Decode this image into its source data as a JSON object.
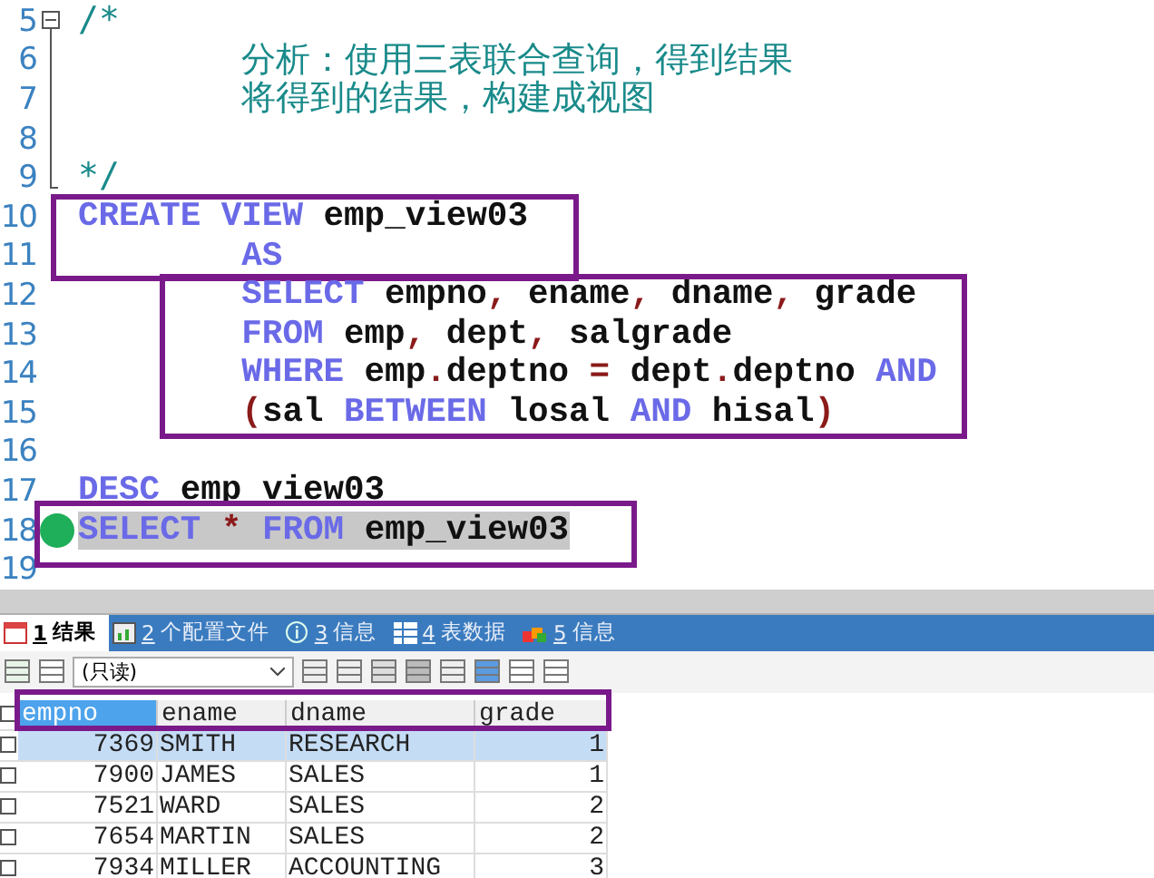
{
  "editor": {
    "blocks": [
      {
        "boxed": false,
        "foldable": true,
        "lines": [
          {
            "number": "5",
            "tokens": [
              {
                "kind": "comment",
                "text": "/*"
              }
            ]
          },
          {
            "number": "6",
            "indent": true,
            "tokens": [
              {
                "kind": "comment",
                "text": "分析：使用三表联合查询，得到结果"
              }
            ]
          },
          {
            "number": "7",
            "indent": true,
            "tokens": [
              {
                "kind": "comment",
                "text": "将得到的结果，构建成视图"
              }
            ]
          },
          {
            "number": "8"
          },
          {
            "number": "9",
            "tokens": [
              {
                "kind": "comment",
                "text": "*/"
              }
            ]
          }
        ]
      },
      {
        "boxed": true,
        "lines": [
          {
            "number": "10",
            "tokens": [
              {
                "kind": "keyword",
                "text": "CREATE VIEW"
              },
              {
                "kind": "ident",
                "text": " emp_view03"
              }
            ]
          },
          {
            "number": "11",
            "indent": true,
            "tokens": [
              {
                "kind": "keyword",
                "text": "AS"
              }
            ]
          }
        ]
      },
      {
        "boxed": true,
        "lines": [
          {
            "number": "12",
            "indent": true,
            "tokens": [
              {
                "kind": "keyword",
                "text": "SELECT"
              },
              {
                "kind": "ident",
                "text": " empno"
              },
              {
                "kind": "punct",
                "text": ","
              },
              {
                "kind": "ident",
                "text": " ename"
              },
              {
                "kind": "punct",
                "text": ","
              },
              {
                "kind": "ident",
                "text": " dname"
              },
              {
                "kind": "punct",
                "text": ","
              },
              {
                "kind": "ident",
                "text": " grade"
              }
            ]
          },
          {
            "number": "13",
            "indent": true,
            "tokens": [
              {
                "kind": "keyword",
                "text": "FROM"
              },
              {
                "kind": "ident",
                "text": " emp"
              },
              {
                "kind": "punct",
                "text": ","
              },
              {
                "kind": "ident",
                "text": " dept"
              },
              {
                "kind": "punct",
                "text": ","
              },
              {
                "kind": "ident",
                "text": " salgrade"
              }
            ]
          },
          {
            "number": "14",
            "indent": true,
            "tokens": [
              {
                "kind": "keyword",
                "text": "WHERE"
              },
              {
                "kind": "ident",
                "text": " emp"
              },
              {
                "kind": "punct",
                "text": "."
              },
              {
                "kind": "ident",
                "text": "deptno "
              },
              {
                "kind": "punct",
                "text": "="
              },
              {
                "kind": "ident",
                "text": " dept"
              },
              {
                "kind": "punct",
                "text": "."
              },
              {
                "kind": "ident",
                "text": "deptno "
              },
              {
                "kind": "keyword",
                "text": "AND"
              }
            ]
          },
          {
            "number": "15",
            "indent": true,
            "tokens": [
              {
                "kind": "punct",
                "text": "("
              },
              {
                "kind": "ident",
                "text": "sal "
              },
              {
                "kind": "keyword",
                "text": "BETWEEN"
              },
              {
                "kind": "ident",
                "text": " losal "
              },
              {
                "kind": "keyword",
                "text": "AND"
              },
              {
                "kind": "ident",
                "text": " hisal"
              },
              {
                "kind": "punct",
                "text": ")"
              }
            ]
          }
        ]
      },
      {
        "boxed": false,
        "lines": [
          {
            "number": "16"
          },
          {
            "number": "17",
            "tokens": [
              {
                "kind": "keyword",
                "text": "DESC"
              },
              {
                "kind": "ident",
                "text": " emp_view03"
              }
            ]
          }
        ]
      },
      {
        "boxed": true,
        "lines": [
          {
            "number": "18",
            "selected": true,
            "cursor": true,
            "tokens": [
              {
                "kind": "keyword",
                "text": "SELECT "
              },
              {
                "kind": "punct",
                "text": "*"
              },
              {
                "kind": "keyword",
                "text": " FROM"
              },
              {
                "kind": "ident",
                "text": " emp_view03"
              }
            ]
          },
          {
            "number": "19"
          }
        ]
      }
    ]
  },
  "result_tabs": [
    {
      "number": "1",
      "label": "结果",
      "selected": true
    },
    {
      "number": "2",
      "label": "个配置文件",
      "selected": false
    },
    {
      "number": "3",
      "label": "信息",
      "selected": false
    },
    {
      "number": "4",
      "label": "表数据",
      "selected": false
    },
    {
      "number": "5",
      "label": "信息",
      "selected": false
    }
  ],
  "toolbar": {
    "mode_select": "(只读)"
  },
  "table": {
    "header_boxed": true,
    "all_checked": false,
    "columns": [
      {
        "label": "empno",
        "kind": "number",
        "selected": true
      },
      {
        "label": "ename",
        "kind": "text",
        "selected": false
      },
      {
        "label": "dname",
        "kind": "text",
        "selected": false
      },
      {
        "label": "grade",
        "kind": "number",
        "selected": false
      }
    ],
    "rows": [
      {
        "selected": true,
        "checked": false,
        "cells": [
          "7369",
          "SMITH",
          "RESEARCH",
          "1"
        ]
      },
      {
        "selected": false,
        "checked": false,
        "cells": [
          "7900",
          "JAMES",
          "SALES",
          "1"
        ]
      },
      {
        "selected": false,
        "checked": false,
        "cells": [
          "7521",
          "WARD",
          "SALES",
          "2"
        ]
      },
      {
        "selected": false,
        "checked": false,
        "cells": [
          "7654",
          "MARTIN",
          "SALES",
          "2"
        ]
      },
      {
        "selected": false,
        "checked": false,
        "cells": [
          "7934",
          "MILLER",
          "ACCOUNTING",
          "3"
        ]
      }
    ]
  }
}
